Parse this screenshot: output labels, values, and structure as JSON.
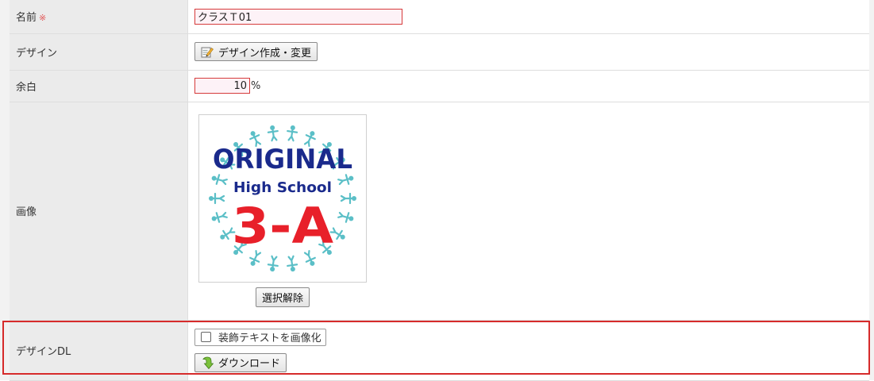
{
  "form": {
    "rows": {
      "name": {
        "label": "名前",
        "required_mark": "※",
        "value": "クラスＴ01"
      },
      "design": {
        "label": "デザイン",
        "button_label": "デザイン作成・変更"
      },
      "margin": {
        "label": "余白",
        "value": "10",
        "unit": "%"
      },
      "image": {
        "label": "画像",
        "logo_text_line1": "ORIGINAL",
        "logo_text_line2": "High School",
        "logo_text_line3": "3-A",
        "deselect_button": "選択解除"
      },
      "design_dl": {
        "label": "デザインDL",
        "checkbox_label": "装飾テキストを画像化",
        "checkbox_checked": false,
        "download_button": "ダウンロード"
      }
    }
  },
  "icons": {
    "design_button_icon": "edit-pencil-icon",
    "download_button_icon": "download-arrow-icon"
  },
  "colors": {
    "required": "#e25353",
    "input_border": "#d63b3b",
    "input_bg": "#fdf2f7",
    "highlight": "#d62b2b",
    "logo_navy": "#1a2a8c",
    "logo_red": "#e8202a",
    "logo_teal": "#5bbfc7"
  }
}
